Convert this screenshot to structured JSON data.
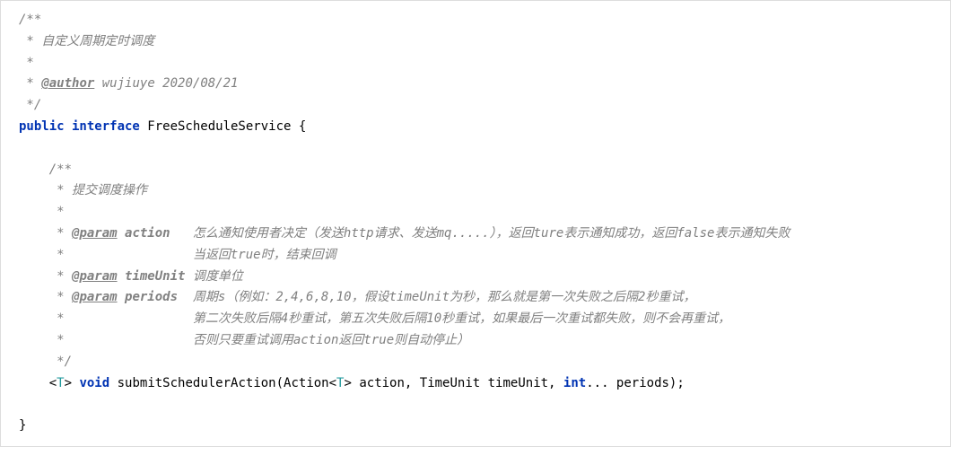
{
  "code": {
    "lines": [
      {
        "indent": 0,
        "type": "comment-open",
        "text": "/**"
      },
      {
        "indent": 0,
        "type": "comment",
        "text": " * 自定义周期定时调度"
      },
      {
        "indent": 0,
        "type": "comment",
        "text": " *"
      },
      {
        "indent": 0,
        "type": "comment-author",
        "prefix": " * ",
        "tag": "@author",
        "rest": " wujiuye 2020/08/21"
      },
      {
        "indent": 0,
        "type": "comment",
        "text": " */"
      },
      {
        "indent": 0,
        "type": "decl",
        "kw": "public interface",
        "name": " FreeScheduleService {"
      },
      {
        "indent": 0,
        "type": "blank",
        "text": ""
      },
      {
        "indent": 1,
        "type": "comment-open",
        "text": "/**"
      },
      {
        "indent": 1,
        "type": "comment",
        "text": " * 提交调度操作"
      },
      {
        "indent": 1,
        "type": "comment",
        "text": " *"
      },
      {
        "indent": 1,
        "type": "comment-param",
        "prefix": " * ",
        "tag": "@param",
        "pname": " action",
        "rest": "   怎么通知使用者决定（发送http请求、发送mq.....），返回ture表示通知成功，返回false表示通知失败"
      },
      {
        "indent": 1,
        "type": "comment",
        "text": " *                 当返回true时，结束回调"
      },
      {
        "indent": 1,
        "type": "comment-param",
        "prefix": " * ",
        "tag": "@param",
        "pname": " timeUnit",
        "rest": " 调度单位"
      },
      {
        "indent": 1,
        "type": "comment-param",
        "prefix": " * ",
        "tag": "@param",
        "pname": " periods",
        "rest": "  周期s（例如：2,4,6,8,10，假设timeUnit为秒，那么就是第一次失败之后隔2秒重试，"
      },
      {
        "indent": 1,
        "type": "comment",
        "text": " *                 第二次失败后隔4秒重试，第五次失败后隔10秒重试，如果最后一次重试都失败，则不会再重试，"
      },
      {
        "indent": 1,
        "type": "comment",
        "text": " *                 否则只要重试调用action返回true则自动停止）"
      },
      {
        "indent": 1,
        "type": "comment",
        "text": " */"
      },
      {
        "indent": 1,
        "type": "method",
        "segments": [
          {
            "cls": "",
            "text": "<"
          },
          {
            "cls": "type-param",
            "text": "T"
          },
          {
            "cls": "",
            "text": "> "
          },
          {
            "cls": "keyword",
            "text": "void"
          },
          {
            "cls": "",
            "text": " submitSchedulerAction(Action<"
          },
          {
            "cls": "type-param",
            "text": "T"
          },
          {
            "cls": "",
            "text": "> action, TimeUnit timeUnit, "
          },
          {
            "cls": "keyword",
            "text": "int"
          },
          {
            "cls": "",
            "text": "... periods);"
          }
        ]
      },
      {
        "indent": 0,
        "type": "blank",
        "text": ""
      },
      {
        "indent": 0,
        "type": "plain",
        "text": "}"
      }
    ]
  }
}
